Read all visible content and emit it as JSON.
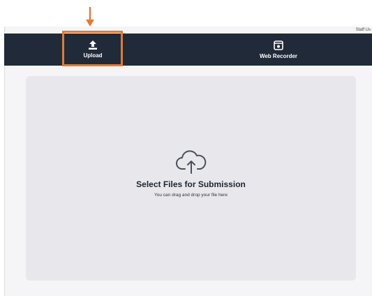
{
  "header": {
    "staff_label": "Staff Us",
    "tabs": [
      {
        "label": "Upload",
        "icon": "upload-icon",
        "highlighted": true
      },
      {
        "label": "Web Recorder",
        "icon": "web-recorder-icon",
        "highlighted": false
      }
    ]
  },
  "dropzone": {
    "icon": "cloud-upload-icon",
    "title": "Select Files for Submission",
    "subtitle": "You can drag and drop your file here"
  },
  "annotation": {
    "color": "#e07b39",
    "arrow_icon": "down-arrow-icon"
  },
  "colors": {
    "topbar": "#212a38",
    "dropzone": "#e8e8ec",
    "page": "#f5f5f7"
  }
}
